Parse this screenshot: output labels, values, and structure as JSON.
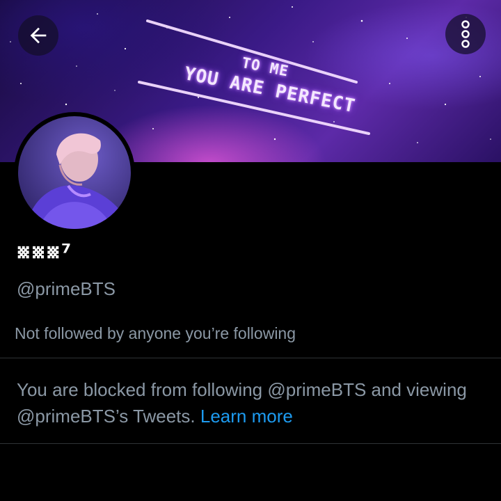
{
  "banner": {
    "neon_line_1": "TO ME",
    "neon_line_2": "YOU ARE PERFECT"
  },
  "header": {
    "back_icon": "arrow-left-icon",
    "more_icon": "more-vertical-icon"
  },
  "profile": {
    "display_name": "␧␧␧⁷",
    "handle": "@primeBTS",
    "followers_context": "Not followed by anyone you’re following"
  },
  "blocked_notice": {
    "text": "You are blocked from following @primeBTS and viewing @primeBTS’s Tweets.",
    "link_label": "Learn more"
  },
  "colors": {
    "background": "#000000",
    "secondary_text": "#8b98a5",
    "link": "#1d9bf0",
    "divider": "#2f3336"
  }
}
